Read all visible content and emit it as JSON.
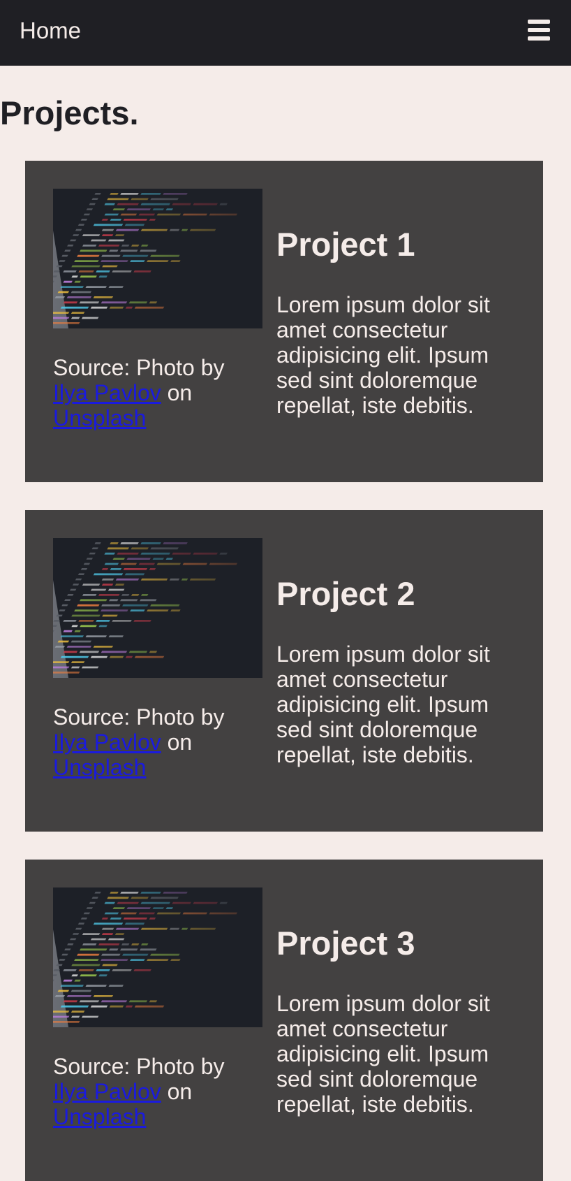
{
  "nav": {
    "home_label": "Home",
    "menu_icon": "hamburger-menu-icon"
  },
  "page": {
    "title": "Projects."
  },
  "projects": [
    {
      "title": "Project 1",
      "description": "Lorem ipsum dolor sit amet consectetur adipisicing elit. Ipsum sed sint doloremque repellat, iste debitis.",
      "credit_prefix": "Source: Photo by",
      "credit_author": "Ilya Pavlov",
      "credit_on": "on",
      "credit_site": "Unsplash"
    },
    {
      "title": "Project 2",
      "description": "Lorem ipsum dolor sit amet consectetur adipisicing elit. Ipsum sed sint doloremque repellat, iste debitis.",
      "credit_prefix": "Source: Photo by",
      "credit_author": "Ilya Pavlov",
      "credit_on": "on",
      "credit_site": "Unsplash"
    },
    {
      "title": "Project 3",
      "description": "Lorem ipsum dolor sit amet consectetur adipisicing elit. Ipsum sed sint doloremque repellat, iste debitis.",
      "credit_prefix": "Source: Photo by",
      "credit_author": "Ilya Pavlov",
      "credit_on": "on",
      "credit_site": "Unsplash"
    }
  ],
  "colors": {
    "navbar_bg": "#1f1f24",
    "page_bg": "#f5ece9",
    "card_bg": "#434141",
    "link": "#1a1adf",
    "text_light": "#f5ece9"
  }
}
